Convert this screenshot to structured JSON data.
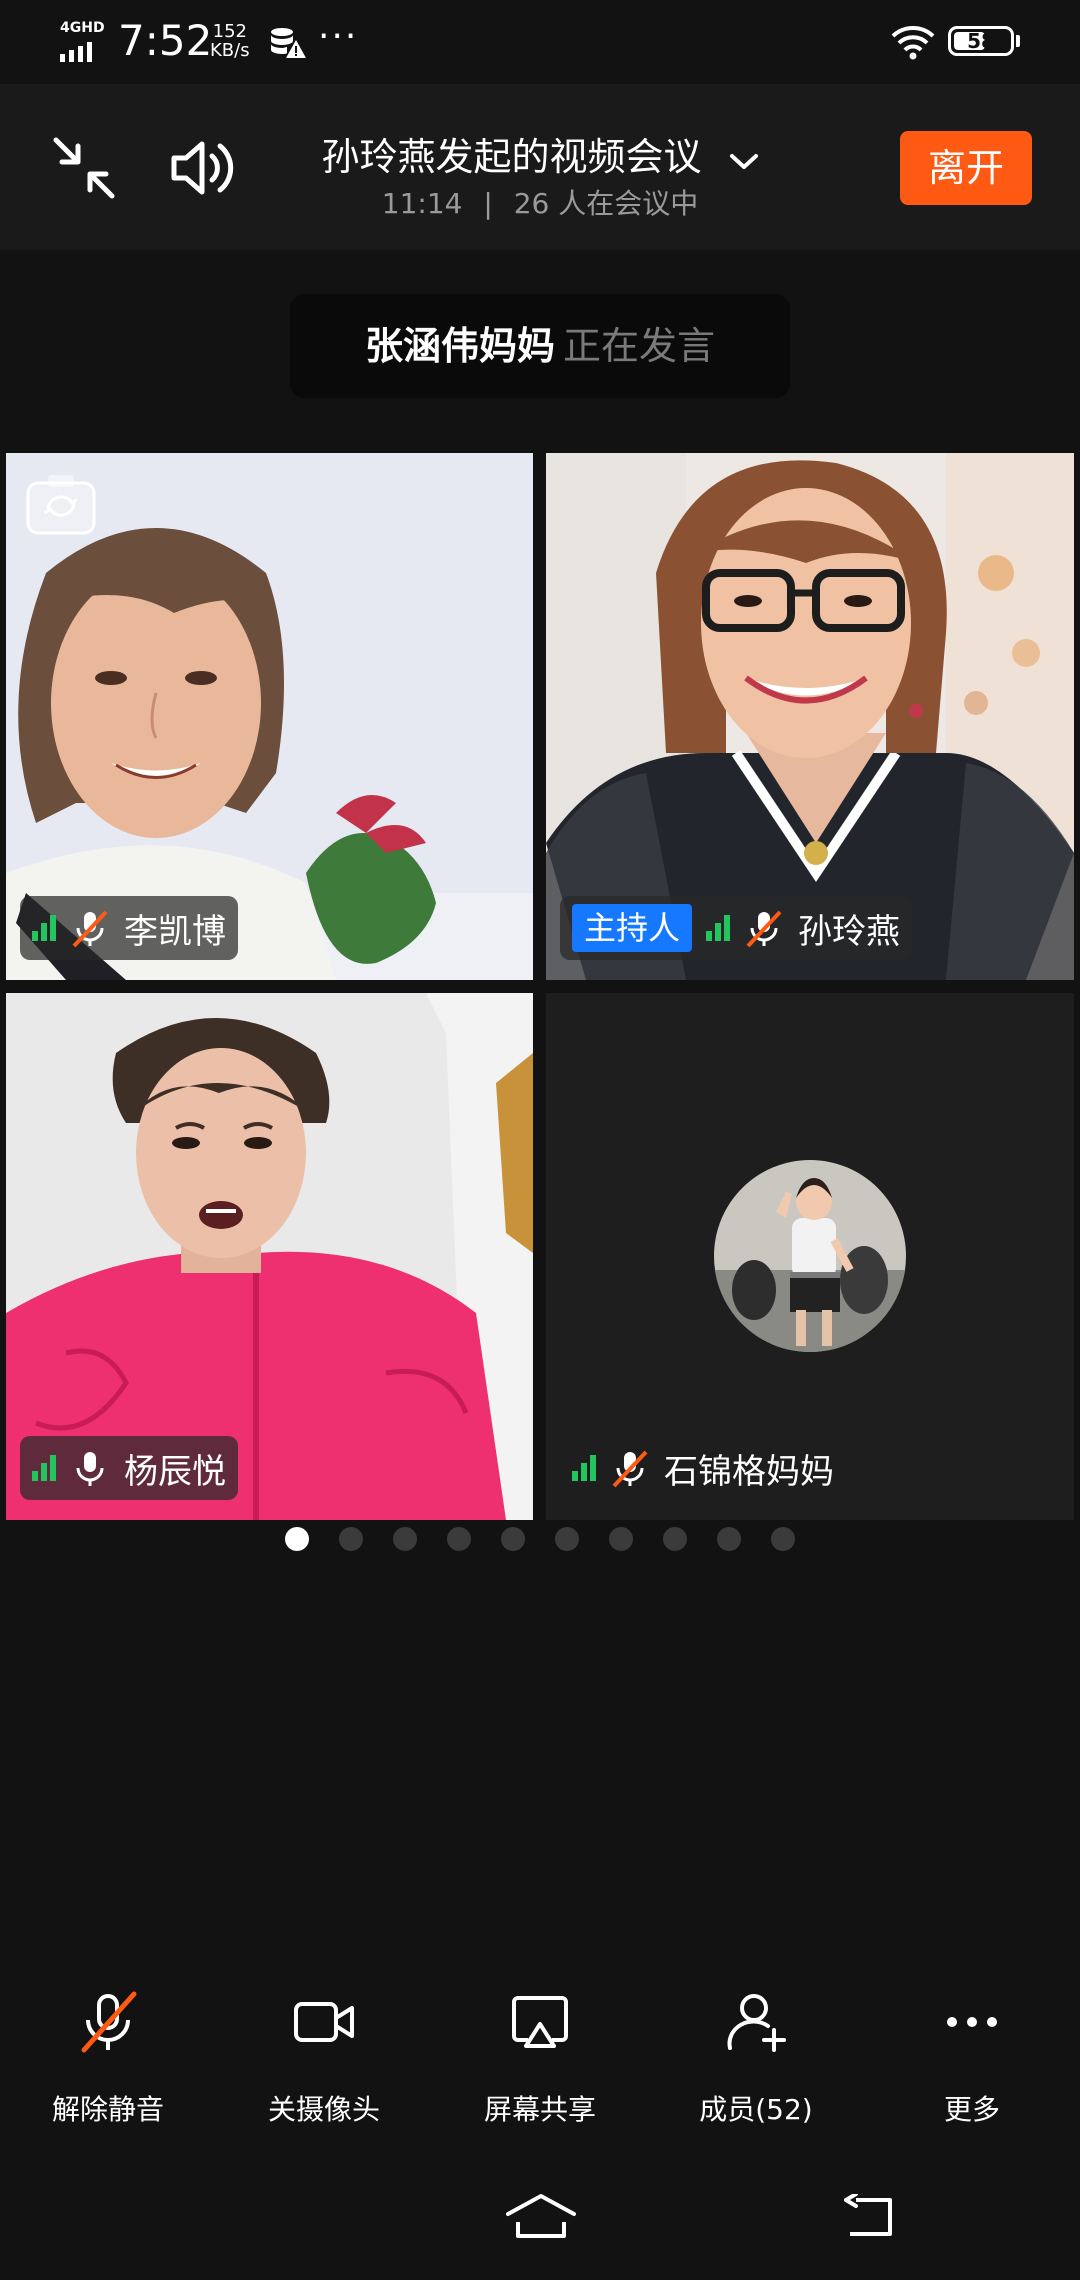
{
  "status_bar": {
    "network": "4GHD",
    "time": "7:52",
    "speed_value": "152",
    "speed_unit": "KB/s",
    "more": "···",
    "battery": "58",
    "battery_level": 0.58
  },
  "header": {
    "title": "孙玲燕发起的视频会议",
    "duration": "11:14",
    "separator": "|",
    "participants_text": "26 人在会议中",
    "leave_label": "离开",
    "minimize_icon": "shrink-arrows-icon",
    "speaker_icon": "speaker-icon",
    "dropdown_icon": "chevron-down-icon"
  },
  "speaking": {
    "name": "张涵伟妈妈",
    "status": "正在发言"
  },
  "participants": [
    {
      "name": "李凯博",
      "mic": "muted"
    },
    {
      "name": "孙玲燕",
      "mic": "muted",
      "host_label": "主持人"
    },
    {
      "name": "杨辰悦",
      "mic": "on"
    },
    {
      "name": "石锦格妈妈",
      "mic": "muted"
    }
  ],
  "pagination": {
    "pages": 10,
    "current": 1
  },
  "toolbar": {
    "unmute": "解除静音",
    "camera_off": "关摄像头",
    "screen_share": "屏幕共享",
    "members": "成员(52)",
    "more": "更多"
  },
  "colors": {
    "accent_leave": "#ff5a14",
    "host_badge": "#1677ff",
    "signal": "#22c55e",
    "muted_slash": "#ff5a14"
  }
}
